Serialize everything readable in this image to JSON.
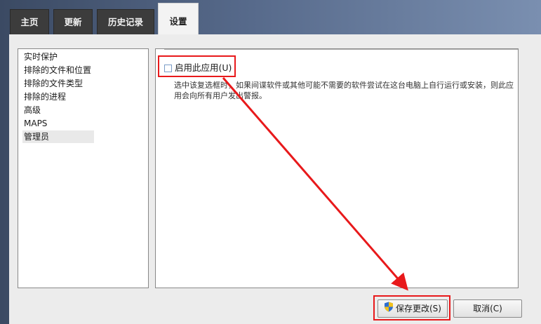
{
  "tabs": [
    "主页",
    "更新",
    "历史记录",
    "设置"
  ],
  "sidebar": {
    "items": [
      "实时保护",
      "排除的文件和位置",
      "排除的文件类型",
      "排除的进程",
      "高级",
      "MAPS",
      "管理员"
    ],
    "selected": "管理员"
  },
  "settings": {
    "checkbox_label": "启用此应用(U)",
    "checkbox_checked": false,
    "description": "选中该复选框时，如果间谍软件或其他可能不需要的软件尝试在这台电脑上自行运行或安装，则此应用会向所有用户发出警报。"
  },
  "buttons": {
    "save": "保存更改(S)",
    "cancel": "取消(C)"
  },
  "colors": {
    "highlight": "#e8191b",
    "shield_blue": "#2f6fd1",
    "shield_yellow": "#f2c11b"
  }
}
